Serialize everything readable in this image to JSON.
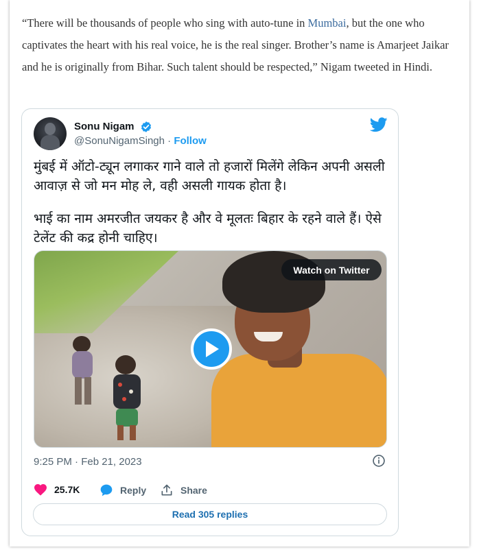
{
  "article": {
    "quote_open": "“There will be thousands of people who sing with auto-tune in ",
    "link": "Mumbai",
    "quote_rest": ", but the one who captivates the heart with his real voice, he is the real singer. Brother’s name is Amarjeet Jaikar and he is originally from Bihar. Such talent should be respected,”",
    "attribution": " Nigam tweeted in Hindi."
  },
  "tweet": {
    "display_name": "Sonu Nigam",
    "handle": "@SonuNigamSingh",
    "separator": " · ",
    "follow_label": "Follow",
    "paragraph1": "मुंबई में ऑटो-ट्यून लगाकर गाने वाले तो हजारों मिलेंगे लेकिन अपनी असली आवाज़ से जो मन मोह ले, वही असली गायक होता है।",
    "paragraph2": "भाई का नाम अमरजीत जयकर है और वे मूलतः बिहार के रहने वाले हैं। ऐसे टेलेंट की कद्र होनी चाहिए।",
    "watch_label": "Watch on Twitter",
    "timestamp": "9:25 PM · Feb 21, 2023",
    "likes": "25.7K",
    "reply_label": "Reply",
    "share_label": "Share",
    "read_replies_label": "Read 305 replies"
  },
  "icons": {
    "verified": "verified-badge-icon",
    "twitter": "twitter-bird-icon",
    "play": "play-icon",
    "info": "info-icon",
    "like": "heart-icon",
    "reply": "speech-bubble-icon",
    "share": "share-upload-icon"
  },
  "colors": {
    "link": "#3b6b9e",
    "twitter_blue": "#1d9bf0",
    "like_pink": "#f91880",
    "muted": "#536471"
  }
}
